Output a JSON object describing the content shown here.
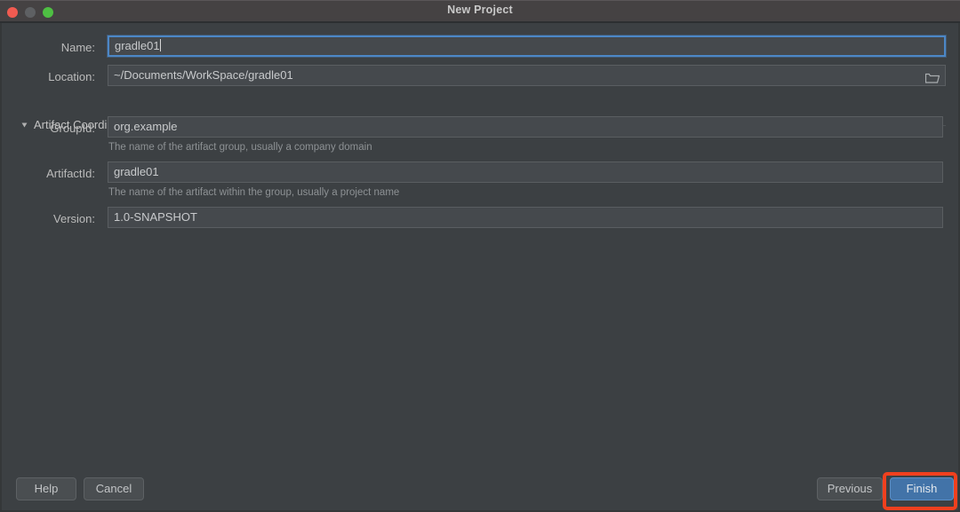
{
  "window": {
    "title": "New Project",
    "controls": [
      {
        "name": "close",
        "color": "#f15b51"
      },
      {
        "name": "minimize",
        "color": "#5e6063"
      },
      {
        "name": "maximize",
        "color": "#4ebf43"
      }
    ]
  },
  "form": {
    "name": {
      "label": "Name:",
      "value": "gradle01",
      "focused": true
    },
    "location": {
      "label": "Location:",
      "value": "~/Documents/WorkSpace/gradle01",
      "browse_icon": "folder-icon"
    },
    "section": {
      "label": "Artifact Coordinates",
      "expanded": true,
      "toggle_icon": "chevron-down-icon"
    },
    "group_id": {
      "label": "GroupId:",
      "value": "org.example",
      "hint": "The name of the artifact group, usually a company domain"
    },
    "artifact_id": {
      "label": "ArtifactId:",
      "value": "gradle01",
      "hint": "The name of the artifact within the group, usually a project name"
    },
    "version": {
      "label": "Version:",
      "value": "1.0-SNAPSHOT"
    }
  },
  "footer": {
    "help_label": "Help",
    "cancel_label": "Cancel",
    "previous_label": "Previous",
    "finish_label": "Finish"
  },
  "annotation": {
    "target": "finish-button",
    "color": "#f0401e"
  }
}
